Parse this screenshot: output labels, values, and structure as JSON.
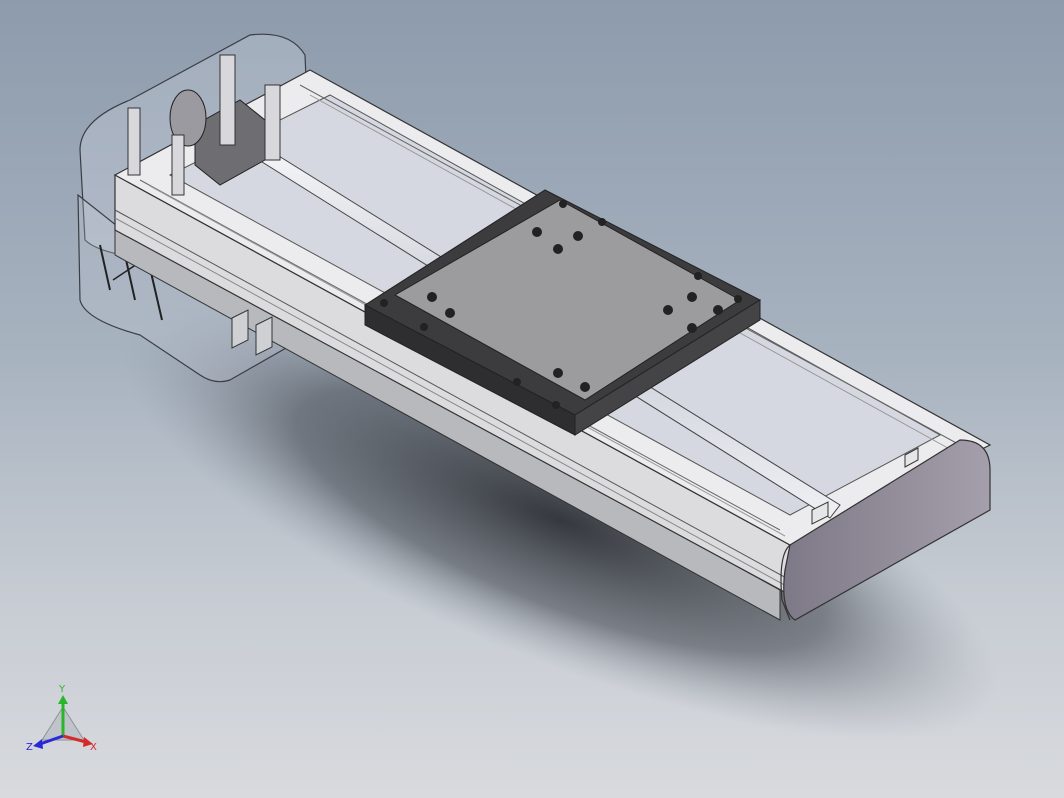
{
  "app": {
    "view": "isometric",
    "model": "linear-slide-module",
    "background": {
      "top": "#8d9bac",
      "bottom": "#d8dade"
    }
  },
  "triad": {
    "x_label": "X",
    "y_label": "Y",
    "z_label": "Z",
    "colors": {
      "x": "#d42a2a",
      "y": "#2bb52b",
      "z": "#2a2ad4"
    }
  },
  "colors": {
    "rail": "#e4e4e6",
    "carriage": "#9a9a9c",
    "carriage_dark": "#3e3e40",
    "end_cap": "#8f8a95",
    "cover": "rgba(210,215,225,0.25)"
  }
}
